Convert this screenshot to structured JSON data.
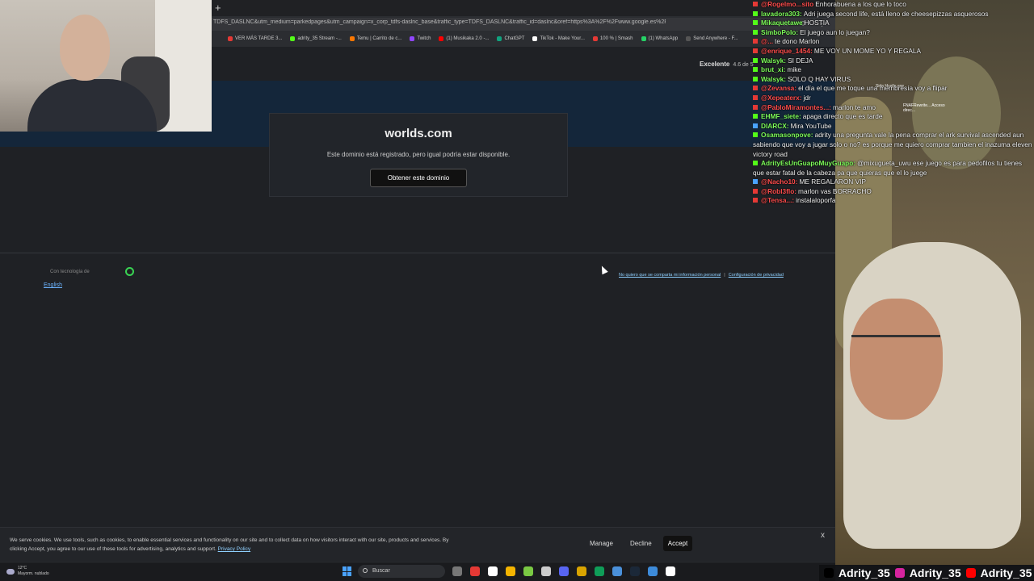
{
  "browser": {
    "new_tab_symbol": "+",
    "url": "TDFS_DASLNC&utm_medium=parkedpages&utm_campaign=x_corp_tdfs-daslnc_base&traffic_type=TDFS_DASLNC&traffic_id=daslnc&oref=https%3A%2F%2Fwww.google.es%2F",
    "bookmarks": [
      {
        "label": "VER MÁS TARDE 3...",
        "color": "#e53935"
      },
      {
        "label": "adrity_35 Stream -...",
        "color": "#53fc18"
      },
      {
        "label": "Temu | Carrito de c...",
        "color": "#fb7701"
      },
      {
        "label": "Twitch",
        "color": "#9146ff"
      },
      {
        "label": "(1) Musikaka 2.0 -...",
        "color": "#ff0000"
      },
      {
        "label": "ChatGPT",
        "color": "#10a37f"
      },
      {
        "label": "TikTok - Make Your...",
        "color": "#ffffff"
      },
      {
        "label": "100 % | Smash",
        "color": "#e53935"
      },
      {
        "label": "(1) WhatsApp",
        "color": "#25d366"
      },
      {
        "label": "Send Anywhere - F...",
        "color": "#555555"
      }
    ]
  },
  "page": {
    "trust_label": "Excelente",
    "trust_score": "4.6 de 5",
    "domain": "worlds.com",
    "message": "Este dominio está registrado, pero igual podría estar disponible.",
    "cta_label": "Obtener este dominio",
    "powered_label": "Con tecnología de",
    "language_link": "English",
    "privacy_optout": "No quiero que se comparta mi información personal",
    "privacy_settings": "Configuración de privacidad"
  },
  "cookie": {
    "text": "We serve cookies. We use tools, such as cookies, to enable essential services and functionality on our site and to collect data on how visitors interact with our site, products and services. By clicking Accept, you agree to our use of these tools for advertising, analytics and support.",
    "privacy_link": "Privacy Policy",
    "manage": "Manage",
    "decline": "Decline",
    "accept": "Accept",
    "close": "x"
  },
  "taskbar": {
    "temp": "12°C",
    "weather": "Mayorm. nublado",
    "search_placeholder": "Buscar",
    "app_colors": [
      "#777777",
      "#e53935",
      "#ffffff",
      "#f4b400",
      "#7ac943",
      "#cccccc",
      "#5865f2",
      "#d9a400",
      "#0f9d58",
      "#4a90d9",
      "#1b2838",
      "#3d8bd9",
      "#ffffff"
    ]
  },
  "chat": {
    "messages": [
      {
        "user": "@Rogelmo...sito",
        "text": "Enhorabuena a los que lo toco",
        "user_color": "#ff4d4d",
        "badge_color": "#e53935"
      },
      {
        "user": "lavadora303:",
        "text": "Adri juega second life, está lleno de cheesepizzas asquerosos",
        "user_color": "#7dfc5a",
        "badge_color": "#53fc18"
      },
      {
        "user": "Mikaquetawe",
        "text": "HOSTIA",
        "user_color": "#7dfc5a",
        "badge_color": "#53fc18"
      },
      {
        "user": "SimboPolo:",
        "text": "El juego aun lo juegan?",
        "user_color": "#7dfc5a",
        "badge_color": "#53fc18"
      },
      {
        "user": "@...",
        "text": "te dono Marlon",
        "user_color": "#ff4d4d",
        "badge_color": "#e53935"
      },
      {
        "user": "@enrique_1454:",
        "text": "ME VOY UN MOME YO Y REGALA",
        "user_color": "#ff4d4d",
        "badge_color": "#e53935"
      },
      {
        "user": "Walsyk:",
        "text": "SI DEJA",
        "user_color": "#7dfc5a",
        "badge_color": "#53fc18"
      },
      {
        "user": "brut_xi:",
        "text": "mike",
        "user_color": "#7dfc5a",
        "badge_color": "#53fc18"
      },
      {
        "user": "Walsyk:",
        "text": "SOLO Q HAY VIRUS",
        "user_color": "#7dfc5a",
        "badge_color": "#53fc18"
      },
      {
        "user": "@Zevansa:",
        "text": "el día el que me toque una membresía voy a flipar",
        "user_color": "#ff4d4d",
        "badge_color": "#e53935"
      },
      {
        "user": "@Xepeaterx:",
        "text": "jdr",
        "user_color": "#ff4d4d",
        "badge_color": "#e53935"
      },
      {
        "user": "@PabloMiramontes...:",
        "text": "marlon te amo",
        "user_color": "#ff4d4d",
        "badge_color": "#e53935"
      },
      {
        "user": "EHMF_siete:",
        "text": "apaga directo que es tarde",
        "user_color": "#7dfc5a",
        "badge_color": "#53fc18"
      },
      {
        "user": "DIARCX:",
        "text": "Mira YouTube",
        "user_color": "#7dfc5a",
        "badge_color": "#4aa3ff"
      },
      {
        "user": "Osamasonpove:",
        "text": "adrity una pregunta vale la pena comprar el ark survival ascended aun sabiendo que voy a jugar solo o no? es porque me quiero comprar tambien el inazuma eleven victory road",
        "user_color": "#7dfc5a",
        "badge_color": "#53fc18"
      },
      {
        "user": "AdrityEsUnGuapoMuyGuapo:",
        "text": "@mixugueta_uwu ese juego es para pedofilos tu tienes que estar fatal de la cabeza pa que quieras que el lo juege",
        "user_color": "#7dfc5a",
        "badge_color": "#53fc18"
      },
      {
        "user": "@Nacho10:",
        "text": "ME REGALARON VIP",
        "user_color": "#ff4d4d",
        "badge_color": "#4aa3ff"
      },
      {
        "user": "@Robl3flo:",
        "text": "marlon vas BORRACHO",
        "user_color": "#ff4d4d",
        "badge_color": "#e53935"
      },
      {
        "user": "@Tensa...:",
        "text": "instalaloporfa",
        "user_color": "#ff4d4d",
        "badge_color": "#e53935"
      }
    ]
  },
  "overlay": {
    "desktop_icon_1": "Side Hustle.exe",
    "desktop_icon_2": "FNAFRewrite... Acceso direc...",
    "socials": [
      {
        "platform": "tiktok",
        "handle": "Adrity_35",
        "color": "#000000"
      },
      {
        "platform": "instagram",
        "handle": "Adrity_35",
        "color": "#d6249f"
      },
      {
        "platform": "youtube",
        "handle": "Adrity_35",
        "color": "#ff0000"
      }
    ]
  }
}
